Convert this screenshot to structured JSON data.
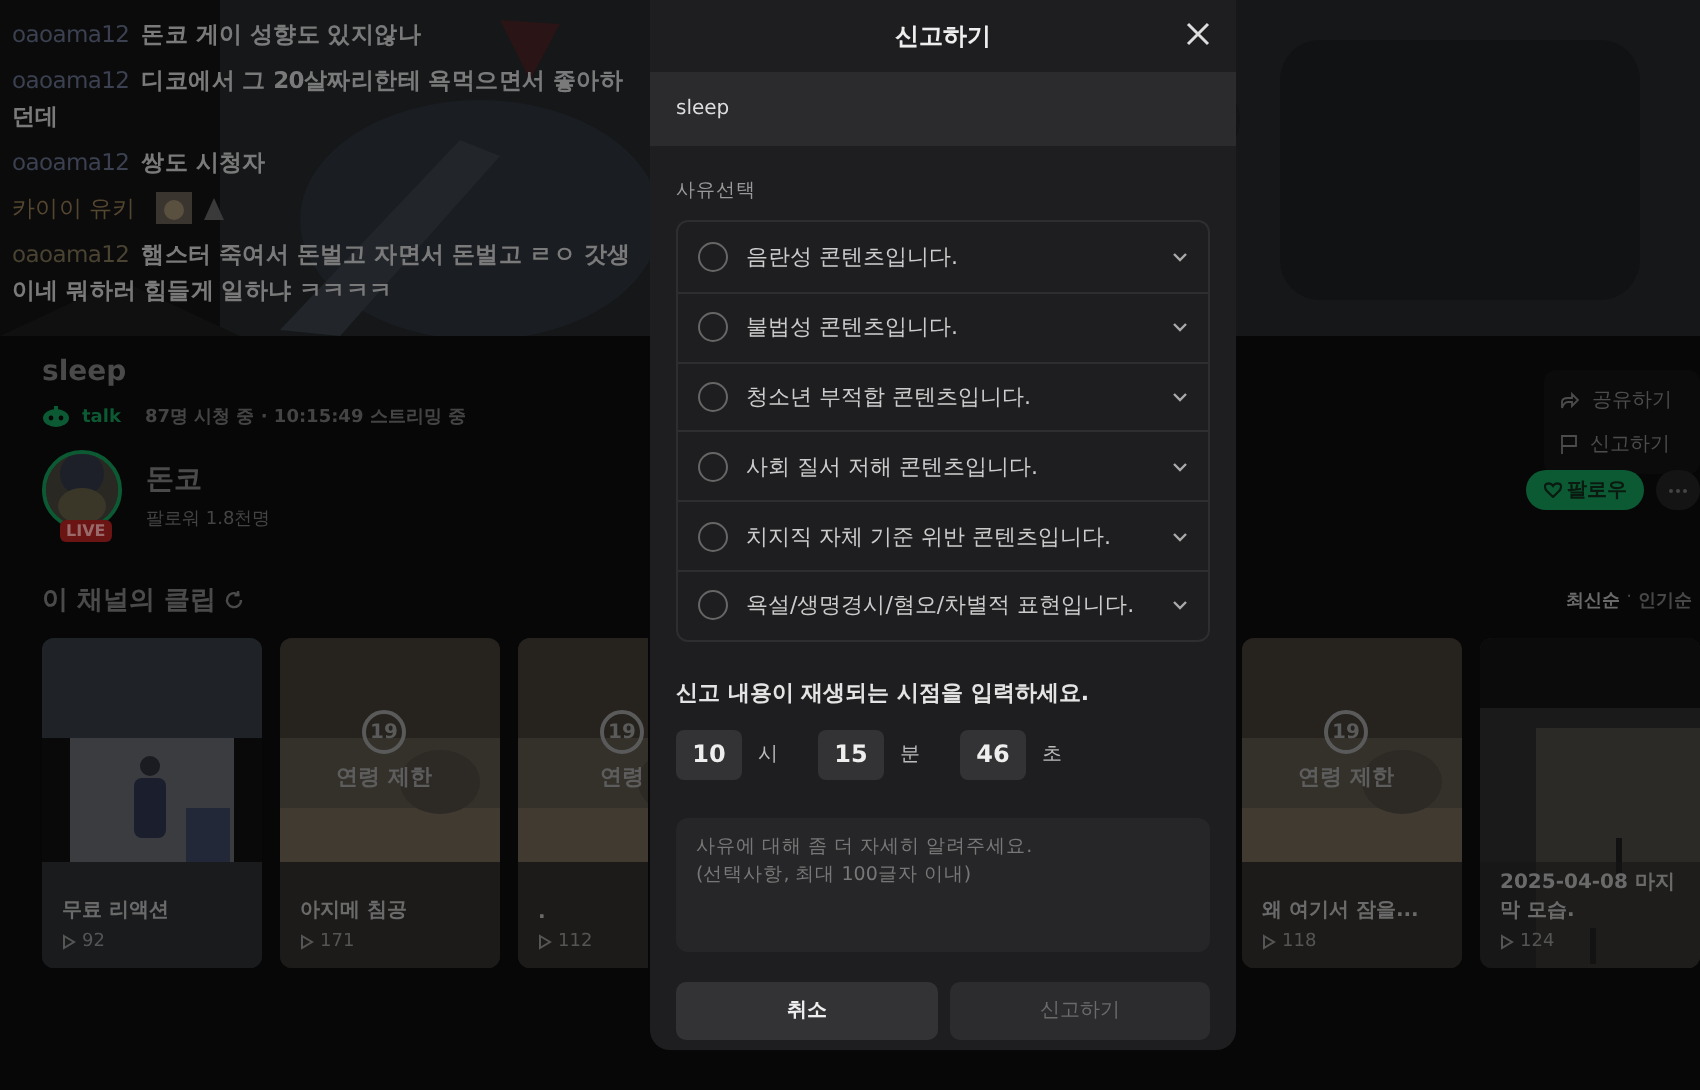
{
  "chat": [
    {
      "kind": "text",
      "user": "oaoama12",
      "color": "#3b4150",
      "message": "돈코 게이 성향도 있지않나"
    },
    {
      "kind": "text",
      "user": "oaoama12",
      "color": "#3b4150",
      "message": "디코에서 그 20살짜리한테 욕먹으면서 좋아하던데"
    },
    {
      "kind": "text",
      "user": "oaoama12",
      "color": "#3b4150",
      "message": "쌍도 시청자"
    },
    {
      "kind": "sticker",
      "user": "카이이 유키",
      "color": "#54462f"
    },
    {
      "kind": "text",
      "user": "oaoama12",
      "color": "#4a4332",
      "message": "햄스터 죽여서 돈벌고 자면서 돈벌고 ㄹㅇ 갓생이네 뭐하러 힘들게 일하냐 ㅋㅋㅋㅋ"
    }
  ],
  "stream": {
    "title": "sleep",
    "talk_label": "talk",
    "stats": "87명 시청 중 · 10:15:49 스트리밍 중"
  },
  "channel": {
    "name": "돈코",
    "followers": "팔로워 1.8천명",
    "live_badge": "LIVE",
    "follow_button": "팔로우"
  },
  "menu": [
    {
      "kind": "share",
      "label": "공유하기"
    },
    {
      "kind": "report",
      "label": "신고하기"
    }
  ],
  "clips": {
    "heading": "이 채널의 클립",
    "sort_separator": "·",
    "sort": [
      {
        "label": "최신순",
        "selected": true
      },
      {
        "label": "인기순",
        "selected": false
      }
    ],
    "cards": [
      {
        "kind": "normal",
        "title": "무료 리액션",
        "views": "92"
      },
      {
        "kind": "restricted",
        "badge": "19",
        "restriction": "연령 제한",
        "title": "아지메 침공",
        "views": "171"
      },
      {
        "kind": "restricted",
        "badge": "19",
        "restriction": "연령",
        "title": ".",
        "views": "112"
      },
      {
        "kind": "restricted",
        "badge": "19",
        "restriction": "연령 제한",
        "title": "왜 여기서 잠을...",
        "views": "118"
      },
      {
        "kind": "screen",
        "title": "2025-04-08 마지막 모습.",
        "views": "124"
      }
    ]
  },
  "report": {
    "title": "신고하기",
    "target": "sleep",
    "reasons_label": "사유선택",
    "reasons": [
      {
        "label": "음란성 콘텐츠입니다.",
        "selected": false
      },
      {
        "label": "불법성 콘텐츠입니다.",
        "selected": false
      },
      {
        "label": "청소년 부적합 콘텐츠입니다.",
        "selected": false
      },
      {
        "label": "사회 질서 저해 콘텐츠입니다.",
        "selected": false
      },
      {
        "label": "치지직 자체 기준 위반 콘텐츠입니다.",
        "selected": false
      },
      {
        "label": "욕설/생명경시/혐오/차별적 표현입니다.",
        "selected": false
      }
    ],
    "time_prompt": "신고 내용이 재생되는 시점을 입력하세요.",
    "time": [
      {
        "value": "10",
        "unit": "시"
      },
      {
        "value": "15",
        "unit": "분"
      },
      {
        "value": "46",
        "unit": "초"
      }
    ],
    "details_placeholder": "사유에 대해 좀 더 자세히 알려주세요.\n(선택사항, 최대 100글자 이내)",
    "cancel": "취소",
    "submit": {
      "label": "신고하기",
      "disabled": true
    }
  }
}
